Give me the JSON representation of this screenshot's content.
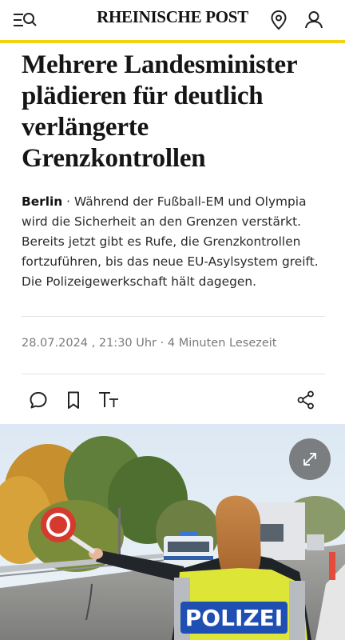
{
  "header": {
    "logo": "RHEINISCHE POST",
    "menu_icon": "menu-search-icon",
    "location_icon": "location-pin-icon",
    "account_icon": "user-icon",
    "accent_color": "#f3d214"
  },
  "article": {
    "headline": "Mehrere Landesminister plädieren für deutlich verlängerte Grenzkontrollen",
    "location": "Berlin",
    "separator": " · ",
    "teaser": "Während der Fußball-EM und Olympia wird die Sicherheit an den Grenzen verstärkt. Bereits jetzt gibt es Rufe, die Grenzkontrollen fortzuführen, bis das neue EU-Asylsystem greift. Die Polizeigewerkschaft hält dagegen.",
    "date": "28.07.2024",
    "time": "21:30 Uhr",
    "reading_time": "4 Minuten Lesezeit"
  },
  "toolbar": {
    "comment_icon": "comment-icon",
    "bookmark_icon": "bookmark-icon",
    "text_size_icon": "text-size-icon",
    "share_icon": "share-icon"
  },
  "image": {
    "vest_text": "POLIZEI",
    "expand_icon": "expand-icon"
  }
}
